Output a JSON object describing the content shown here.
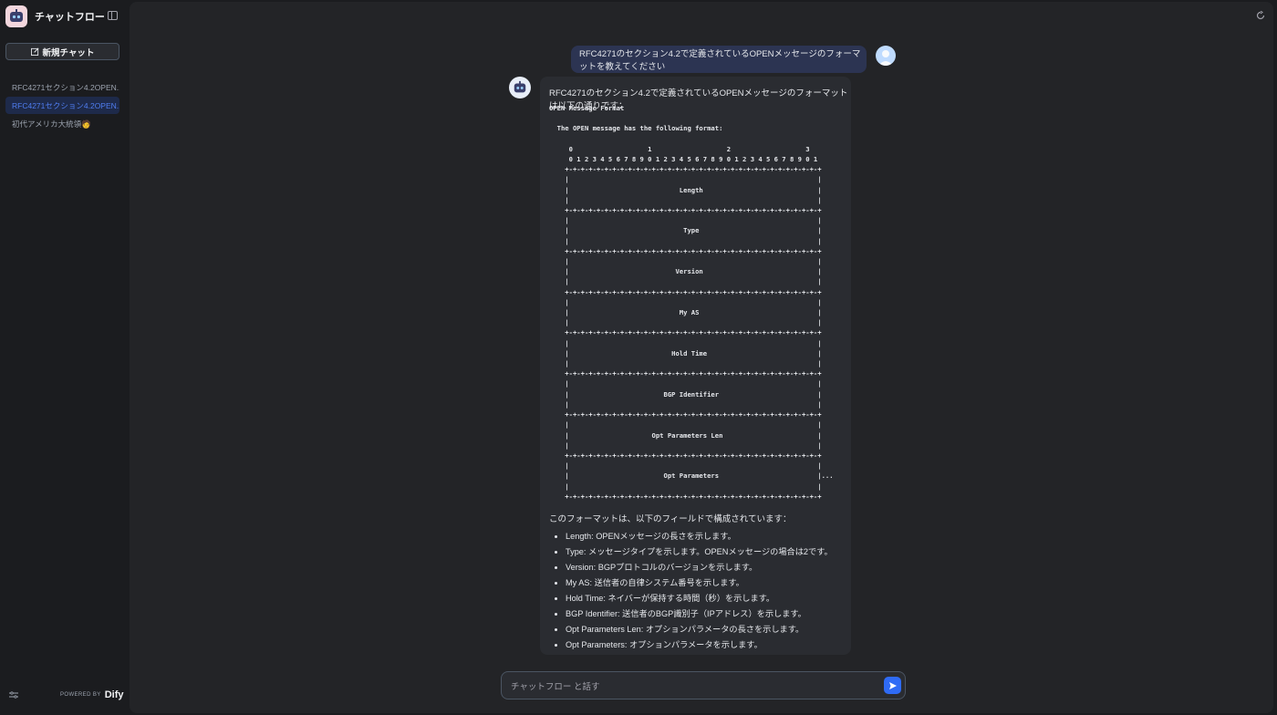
{
  "sidebar": {
    "app_name": "チャットフロー",
    "new_chat_label": "新規チャット",
    "conversations": [
      {
        "label": "RFC4271セクション4.2OPEN..."
      },
      {
        "label": "RFC4271セクション4.2OPEN..."
      },
      {
        "label": "初代アメリカ大統領🧑"
      }
    ],
    "powered_by": "POWERED BY",
    "brand": "Dify"
  },
  "chat": {
    "user_message": "RFC4271のセクション4.2で定義されているOPENメッセージのフォーマットを教えてください",
    "answer_intro": "RFC4271のセクション4.2で定義されているOPENメッセージのフォーマットは以下の通りです：",
    "code_block": "OPEN Message Format\n\n  The OPEN message has the following format:\n\n     0                   1                   2                   3\n     0 1 2 3 4 5 6 7 8 9 0 1 2 3 4 5 6 7 8 9 0 1 2 3 4 5 6 7 8 9 0 1\n    +-+-+-+-+-+-+-+-+-+-+-+-+-+-+-+-+-+-+-+-+-+-+-+-+-+-+-+-+-+-+-+-+\n    |                                                               |\n    |                            Length                             |\n    |                                                               |\n    +-+-+-+-+-+-+-+-+-+-+-+-+-+-+-+-+-+-+-+-+-+-+-+-+-+-+-+-+-+-+-+-+\n    |                                                               |\n    |                             Type                              |\n    |                                                               |\n    +-+-+-+-+-+-+-+-+-+-+-+-+-+-+-+-+-+-+-+-+-+-+-+-+-+-+-+-+-+-+-+-+\n    |                                                               |\n    |                           Version                             |\n    |                                                               |\n    +-+-+-+-+-+-+-+-+-+-+-+-+-+-+-+-+-+-+-+-+-+-+-+-+-+-+-+-+-+-+-+-+\n    |                                                               |\n    |                            My AS                              |\n    |                                                               |\n    +-+-+-+-+-+-+-+-+-+-+-+-+-+-+-+-+-+-+-+-+-+-+-+-+-+-+-+-+-+-+-+-+\n    |                                                               |\n    |                          Hold Time                            |\n    |                                                               |\n    +-+-+-+-+-+-+-+-+-+-+-+-+-+-+-+-+-+-+-+-+-+-+-+-+-+-+-+-+-+-+-+-+\n    |                                                               |\n    |                        BGP Identifier                         |\n    |                                                               |\n    +-+-+-+-+-+-+-+-+-+-+-+-+-+-+-+-+-+-+-+-+-+-+-+-+-+-+-+-+-+-+-+-+\n    |                                                               |\n    |                     Opt Parameters Len                        |\n    |                                                               |\n    +-+-+-+-+-+-+-+-+-+-+-+-+-+-+-+-+-+-+-+-+-+-+-+-+-+-+-+-+-+-+-+-+\n    |                                                               |\n    |                        Opt Parameters                         |...\n    |                                                               |\n    +-+-+-+-+-+-+-+-+-+-+-+-+-+-+-+-+-+-+-+-+-+-+-+-+-+-+-+-+-+-+-+-+",
    "fields_intro": "このフォーマットは、以下のフィールドで構成されています：",
    "fields": [
      "Length: OPENメッセージの長さを示します。",
      "Type: メッセージタイプを示します。OPENメッセージの場合は2です。",
      "Version: BGPプロトコルのバージョンを示します。",
      "My AS: 送信者の自律システム番号を示します。",
      "Hold Time: ネイバーが保持する時間（秒）を示します。",
      "BGP Identifier: 送信者のBGP識別子（IPアドレス）を示します。",
      "Opt Parameters Len: オプションパラメータの長さを示します。",
      "Opt Parameters: オプションパラメータを示します。"
    ]
  },
  "composer": {
    "placeholder": "チャットフロー と話す"
  },
  "colors": {
    "accent": "#2f6bf5",
    "active_item_text": "#4f7df0",
    "user_bubble": "#2c3452"
  }
}
